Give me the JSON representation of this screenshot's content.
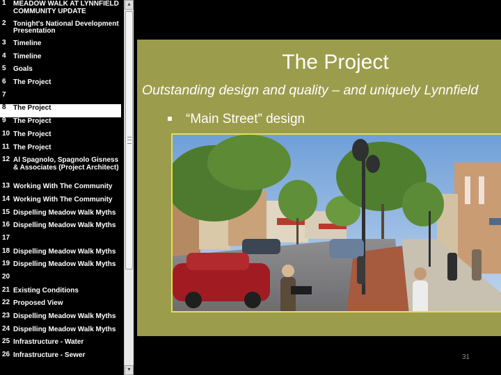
{
  "outline": {
    "items": [
      {
        "num": "1",
        "text": "MEADOW WALK AT LYNNFIELD COMMUNITY UPDATE",
        "lines": 2
      },
      {
        "num": "2",
        "text": "Tonight's National Development Presentation",
        "lines": 2
      },
      {
        "num": "3",
        "text": "Timeline",
        "lines": 1
      },
      {
        "num": "4",
        "text": "Timeline",
        "lines": 1
      },
      {
        "num": "5",
        "text": "Goals",
        "lines": 1
      },
      {
        "num": "6",
        "text": "The Project",
        "lines": 1
      },
      {
        "num": "7",
        "text": "",
        "lines": 1
      },
      {
        "num": "8",
        "text": "The Project",
        "lines": 1,
        "selected": true
      },
      {
        "num": "9",
        "text": "The Project",
        "lines": 1
      },
      {
        "num": "10",
        "text": "The Project",
        "lines": 1
      },
      {
        "num": "11",
        "text": "The Project",
        "lines": 1
      },
      {
        "num": "12",
        "text": "Al Spagnolo, Spagnolo Gisness & Associates (Project Architect)",
        "lines": 3
      },
      {
        "num": "13",
        "text": "Working With The Community",
        "lines": 1
      },
      {
        "num": "14",
        "text": "Working With The Community",
        "lines": 1
      },
      {
        "num": "15",
        "text": "Dispelling Meadow Walk Myths",
        "lines": 1
      },
      {
        "num": "16",
        "text": "Dispelling Meadow Walk Myths",
        "lines": 1
      },
      {
        "num": "17",
        "text": "",
        "lines": 1
      },
      {
        "num": "18",
        "text": "Dispelling Meadow Walk Myths",
        "lines": 1
      },
      {
        "num": "19",
        "text": "Dispelling Meadow Walk Myths",
        "lines": 1
      },
      {
        "num": "20",
        "text": "",
        "lines": 1
      },
      {
        "num": "21",
        "text": "Existing Conditions",
        "lines": 1
      },
      {
        "num": "22",
        "text": "Proposed View",
        "lines": 1
      },
      {
        "num": "23",
        "text": "Dispelling Meadow Walk Myths",
        "lines": 1
      },
      {
        "num": "24",
        "text": "Dispelling Meadow Walk Myths",
        "lines": 1
      },
      {
        "num": "25",
        "text": "Infrastructure - Water",
        "lines": 1
      },
      {
        "num": "26",
        "text": "Infrastructure - Sewer",
        "lines": 1
      }
    ]
  },
  "slide": {
    "title": "The Project",
    "subtitle": "Outstanding design and quality – and uniquely Lynnfield",
    "bullet": "“Main Street” design",
    "image_icon": "street-rendering-image",
    "number": "31"
  },
  "colors": {
    "slide_background": "#9c9c4d",
    "photo_border": "#e8e04a",
    "outline_background": "#000000",
    "selected_background": "#ffffff"
  }
}
